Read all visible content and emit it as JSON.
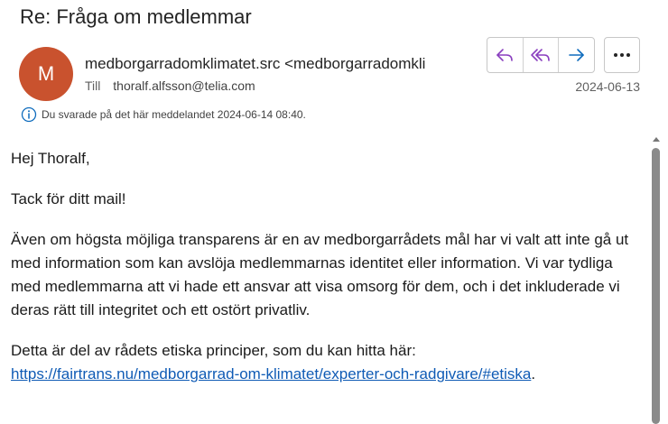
{
  "email": {
    "subject": "Re: Fråga om medlemmar",
    "avatar_initial": "M",
    "sender": "medborgarradomklimatet.src <medborgarradomkli",
    "to_label": "Till",
    "to_address": "thoralf.alfsson@telia.com",
    "date": "2024-06-13",
    "replied_info": "Du svarade på det här meddelandet 2024-06-14 08:40."
  },
  "body": {
    "greeting": "Hej Thoralf,",
    "thanks": "Tack för ditt mail!",
    "paragraph": "Även om högsta möjliga transparens är en av medborgarrådets mål har vi valt att inte gå ut med information som kan avslöja medlemmarnas identitet eller information. Vi var tydliga med medlemmarna att vi hade ett ansvar att visa omsorg för dem, och i det inkluderade vi deras rätt till integritet och ett ostört privatliv.",
    "closing_text": "Detta är del av rådets etiska principer, som du kan hitta här:",
    "link_text": "https://fairtrans.nu/medborgarrad-om-klimatet/experter-och-radgivare/#etiska",
    "link_suffix": "."
  },
  "colors": {
    "avatar_bg": "#c9522e",
    "accent_purple": "#8a3fbf",
    "accent_blue": "#0f5bb5",
    "info_icon": "#0f6cbd"
  },
  "icons": {
    "reply": "reply-icon",
    "reply_all": "reply-all-icon",
    "forward": "forward-icon",
    "more": "more-options-icon",
    "info": "info-icon",
    "scroll_up": "chevron-up-icon"
  }
}
